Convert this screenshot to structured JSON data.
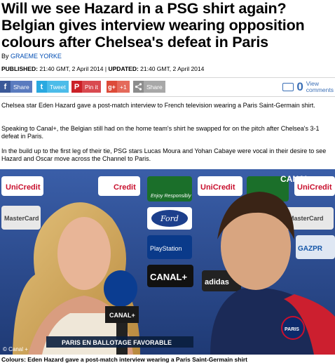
{
  "article": {
    "headline": "Will we see Hazard in a PSG shirt again? Belgian gives interview wearing opposition colours after Chelsea's defeat in Paris",
    "by_prefix": "By",
    "author": "GRAEME YORKE",
    "published_label": "PUBLISHED:",
    "published_value": "21:40 GMT, 2 April 2014",
    "separator": "|",
    "updated_label": "UPDATED:",
    "updated_value": "21:40 GMT, 2 April 2014",
    "paragraphs": [
      "Chelsea star Eden Hazard gave a post-match interview to French television wearing a Paris Saint-Germain shirt.",
      "Speaking to Canal+, the Belgian still had on the home team's shirt he swapped for on the pitch after Chelsea's 3-1 defeat in Paris.",
      "In the build up to the first leg of their tie, PSG stars Lucas Moura and Yohan Cabaye were vocal in their desire to see Hazard and Oscar move across the Channel to Paris."
    ],
    "caption": "Colours: Eden Hazard gave a post-match interview wearing a Paris Saint-Germain shirt"
  },
  "share": {
    "facebook": {
      "icon": "f",
      "label": "Share",
      "color": "#3b5998"
    },
    "twitter": {
      "icon": "t",
      "label": "Tweet",
      "color": "#2aa9e0"
    },
    "pinterest": {
      "icon": "P",
      "label": "Pin it",
      "color": "#cb2027"
    },
    "googleplus": {
      "icon": "g+",
      "label": "+1",
      "color": "#dd4b39"
    },
    "generic": {
      "icon": "<",
      "label": "Share",
      "color": "#9a9a9a"
    },
    "comments_count": "0",
    "comments_label_line1": "View",
    "comments_label_line2": "comments"
  },
  "photo": {
    "credit": "© Canal +",
    "banner_text": "PARIS EN BALLOTAGE FAVORABLE",
    "channel_logo": "CANAL+",
    "mic_logo": "CANAL+",
    "board_texts": {
      "unicredit": "UniCredit",
      "credit": "Credit",
      "mastercard": "MasterCard",
      "ford": "Ford",
      "playstation": "PlayStation",
      "canal": "CANAL+",
      "heineken": "Enjoy Responsibly",
      "adidas": "adidas",
      "gazprom": "GAZPR",
      "psg_badge": "PARIS"
    }
  }
}
